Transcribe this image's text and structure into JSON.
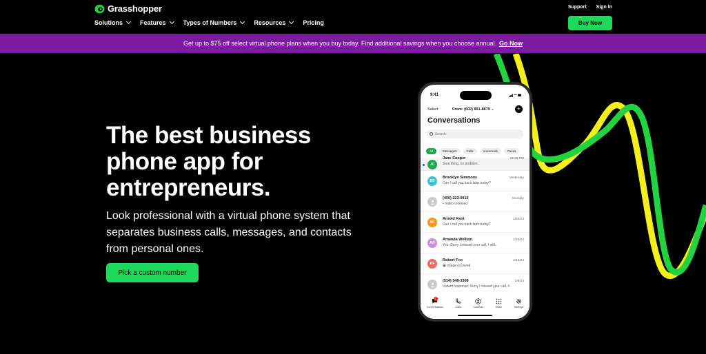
{
  "nav": {
    "logo_text": "Grasshopper",
    "menu": [
      {
        "label": "Solutions",
        "dropdown": true
      },
      {
        "label": "Features",
        "dropdown": true
      },
      {
        "label": "Types of Numbers",
        "dropdown": true
      },
      {
        "label": "Resources",
        "dropdown": true
      },
      {
        "label": "Pricing",
        "dropdown": false
      }
    ],
    "support": "Support",
    "signin": "Sign In",
    "buy_now": "Buy Now"
  },
  "promo": {
    "text": "Get up to $75 off select virtual phone plans when you buy today. Find additional savings when you choose annual.",
    "link": "Go Now"
  },
  "hero": {
    "title": "The best business phone app for entrepreneurs.",
    "subtitle": "Look professional with a virtual phone system that separates business calls, messages, and contacts from personal ones.",
    "cta": "Pick a custom number"
  },
  "phone": {
    "time": "9:41",
    "select": "Select",
    "from": "From: (602) 851-8879",
    "title": "Conversations",
    "search_placeholder": "Search",
    "chips": [
      "All",
      "Messages",
      "Calls",
      "Voicemails",
      "Faxes"
    ],
    "conversations": [
      {
        "initials": "JC",
        "name": "Jane Cooper",
        "message": "Sure thing, no problem.",
        "time": "12:25 PM",
        "color": "#1fa84a",
        "unread": true
      },
      {
        "initials": "BS",
        "name": "Brooklyn Simmons",
        "message": "Can I call you back later today?",
        "time": "Yesterday",
        "color": "#39c4cf",
        "unread": false
      },
      {
        "initials": "",
        "name": "(400) 223-0915",
        "message": "Video received",
        "time": "Monday",
        "color": "#c9c9c9",
        "unread": false
      },
      {
        "initials": "AK",
        "name": "Arnold Kent",
        "message": "Can I call you back later today?",
        "time": "2/20/24",
        "color": "#f39a1e",
        "unread": false
      },
      {
        "initials": "AW",
        "name": "Amanda Wellton",
        "message": "You: Sorry I missed your call, I will...",
        "time": "2/20/24",
        "color": "#c98ee0",
        "unread": false
      },
      {
        "initials": "RF",
        "name": "Robert Fox",
        "message": "Image received",
        "time": "2/12/24",
        "color": "#ef6a5f",
        "unread": false
      },
      {
        "initials": "",
        "name": "(514) 548-3308",
        "message": "Instant response: Sorry I missed your call, I will...",
        "time": "2/8/24",
        "color": "#c9c9c9",
        "unread": false
      }
    ],
    "tabs": [
      {
        "label": "Conversations",
        "icon": "chat-icon",
        "badge": "1"
      },
      {
        "label": "Calls",
        "icon": "phone-icon"
      },
      {
        "label": "Contacts",
        "icon": "contact-icon"
      },
      {
        "label": "Dialer",
        "icon": "dialpad-icon"
      },
      {
        "label": "Settings",
        "icon": "gear-icon"
      }
    ]
  },
  "colors": {
    "brand_green": "#1ed95a",
    "promo_purple": "#7a1ba0",
    "wave_yellow": "#f5ef1c",
    "wave_green": "#22d33f"
  }
}
